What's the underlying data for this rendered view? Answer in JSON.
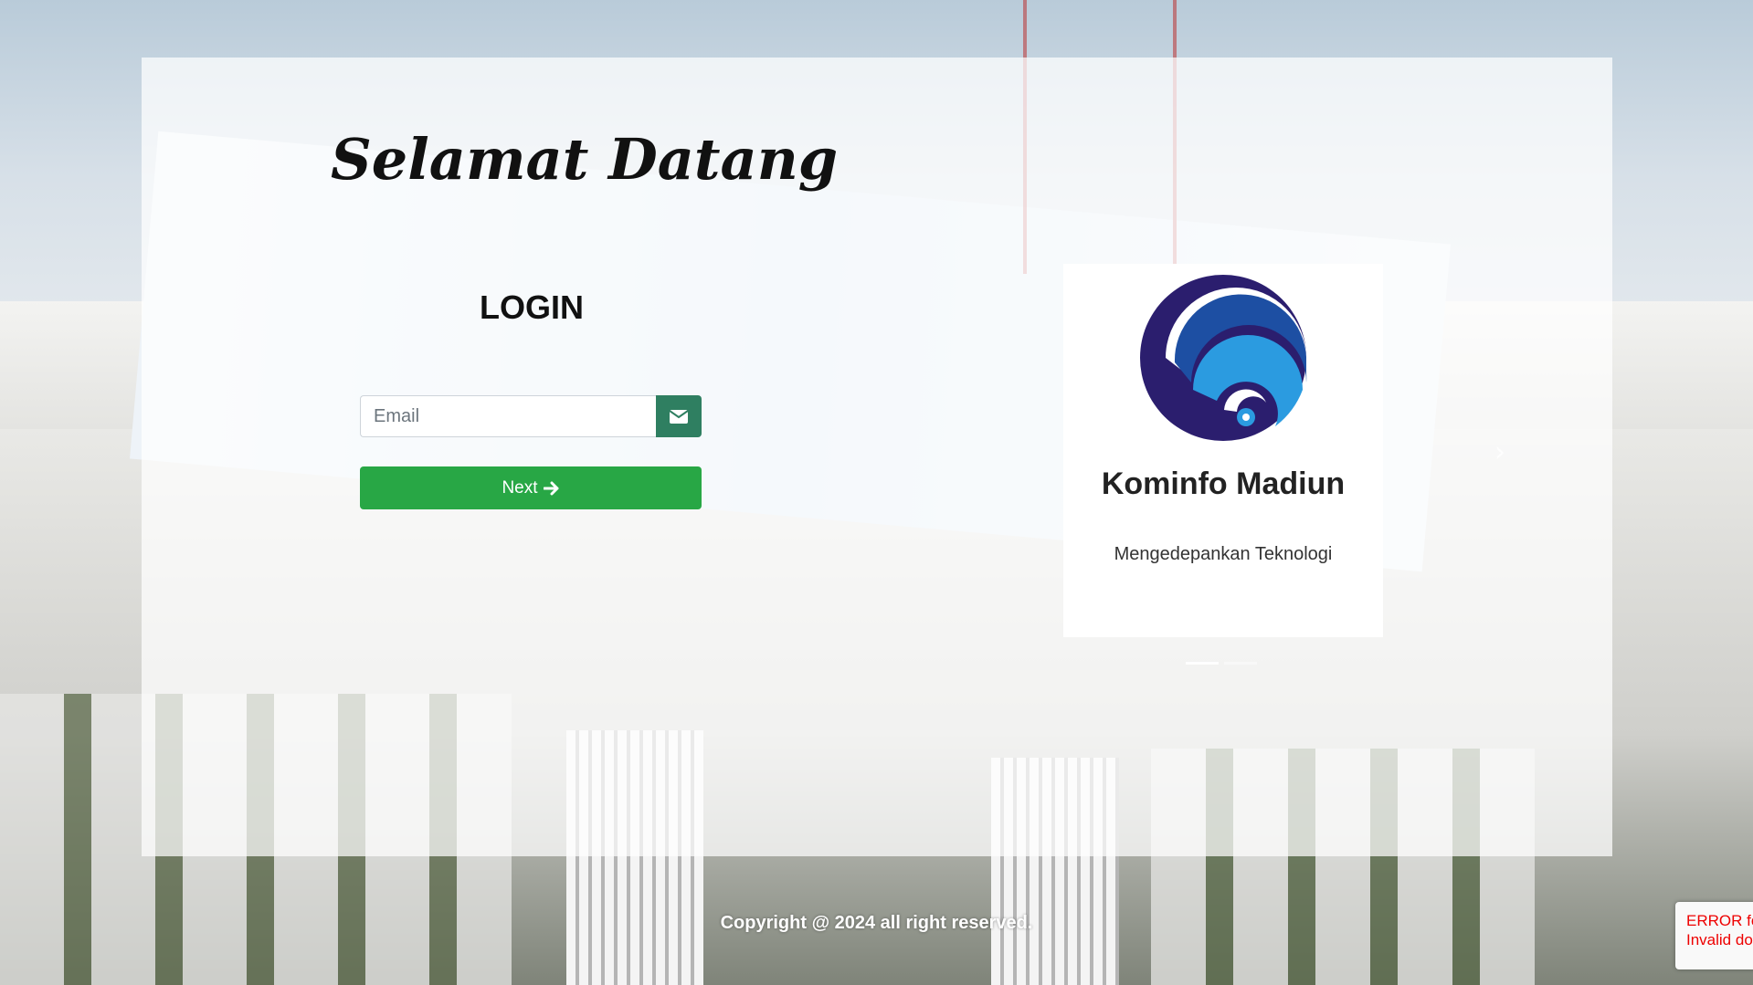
{
  "welcome": "Selamat Datang",
  "login": {
    "title": "LOGIN",
    "email_placeholder": "Email",
    "email_value": "",
    "next_label": "Next"
  },
  "card": {
    "title": "Kominfo Madiun",
    "subtitle": "Mengedepankan Teknologi"
  },
  "footer": {
    "copyright": "Copyright @ 2024 all right reserved."
  },
  "recaptcha": {
    "line1": "ERROR fo",
    "line2": "Invalid do"
  },
  "colors": {
    "primary_green": "#28a745",
    "addon_green": "#2f7f61",
    "logo_dark": "#2b1e6e",
    "logo_mid": "#1d4fa3",
    "logo_light": "#2b9be0",
    "error_red": "#e00000"
  },
  "icons": {
    "email_addon": "envelope-icon",
    "next_arrow": "arrow-right-icon",
    "carousel_next": "chevron-right-icon",
    "logo": "kominfo-logo"
  },
  "carousel": {
    "slides": 2,
    "active_slide": 1
  }
}
